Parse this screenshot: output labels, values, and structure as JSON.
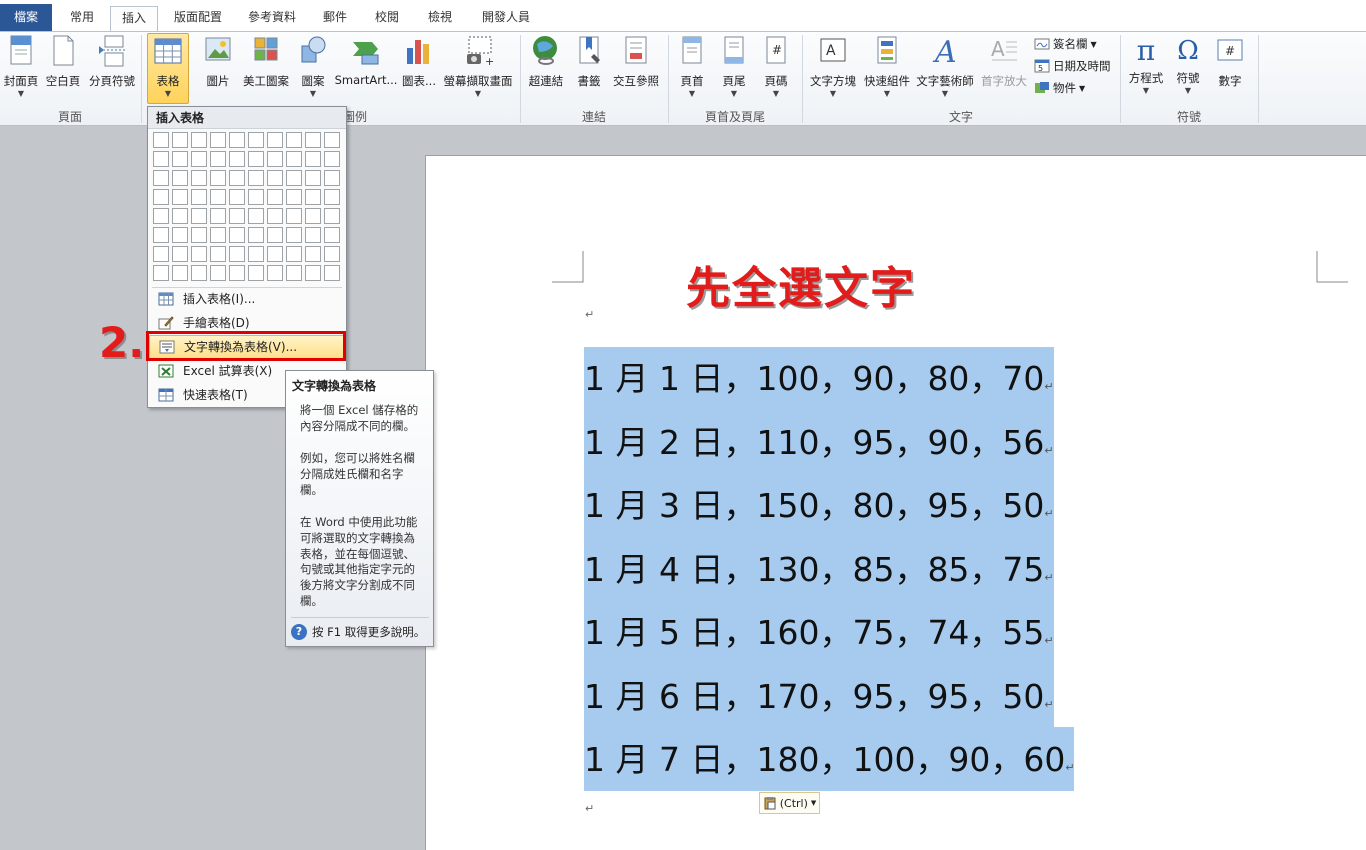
{
  "tabs": [
    {
      "id": "file",
      "label": "檔案"
    },
    {
      "id": "home",
      "label": "常用"
    },
    {
      "id": "insert",
      "label": "插入"
    },
    {
      "id": "layout",
      "label": "版面配置"
    },
    {
      "id": "references",
      "label": "參考資料"
    },
    {
      "id": "mailings",
      "label": "郵件"
    },
    {
      "id": "review",
      "label": "校閱"
    },
    {
      "id": "view",
      "label": "檢視"
    },
    {
      "id": "developer",
      "label": "開發人員"
    }
  ],
  "ribbon": {
    "groups": {
      "pages": "頁面",
      "illustrations": "圖例",
      "links": "連結",
      "header_footer": "頁首及頁尾",
      "text": "文字",
      "symbols": "符號"
    },
    "buttons": {
      "cover_page": "封面頁",
      "blank_page": "空白頁",
      "page_break": "分頁符號",
      "table": "表格",
      "picture": "圖片",
      "clip_art": "美工圖案",
      "shapes": "圖案",
      "smartart": "SmartArt...",
      "chart": "圖表...",
      "screenshot": "螢幕擷取畫面",
      "hyperlink": "超連結",
      "bookmark": "書籤",
      "cross_reference": "交互參照",
      "header": "頁首",
      "footer": "頁尾",
      "page_number": "頁碼",
      "text_box": "文字方塊",
      "quick_parts": "快速組件",
      "wordart": "文字藝術師",
      "drop_cap": "首字放大",
      "signature_line": "簽名欄",
      "date_time": "日期及時間",
      "object": "物件",
      "equation": "方程式",
      "symbol": "符號",
      "number": "數字"
    }
  },
  "table_menu": {
    "title": "插入表格",
    "items": [
      {
        "label": "插入表格(I)..."
      },
      {
        "label": "手繪表格(D)"
      },
      {
        "label": "文字轉換為表格(V)..."
      },
      {
        "label": "Excel 試算表(X)"
      },
      {
        "label": "快速表格(T)"
      }
    ]
  },
  "annotation": {
    "step": "2.",
    "heading": "先全選文字"
  },
  "tooltip": {
    "title": "文字轉換為表格",
    "p1": "將一個 Excel 儲存格的內容分隔成不同的欄。",
    "p2": "例如，您可以將姓名欄分隔成姓氏欄和名字欄。",
    "p3": "在 Word 中使用此功能可將選取的文字轉換為表格，並在每個逗號、句號或其他指定字元的後方將文字分割成不同欄。",
    "help": "按 F1 取得更多說明。"
  },
  "document": {
    "rows": [
      "1 月 1 日，100，90，80，70",
      "1 月 2 日，110，95，90，56",
      "1 月 3 日，150，80，95，50",
      "1 月 4 日，130，85，85，75",
      "1 月 5 日，160，75，74，55",
      "1 月 6 日，170，95，95，50",
      "1 月 7 日，180，100，90，60"
    ],
    "paragraph_mark": "↵",
    "paste_options": "(Ctrl)"
  }
}
